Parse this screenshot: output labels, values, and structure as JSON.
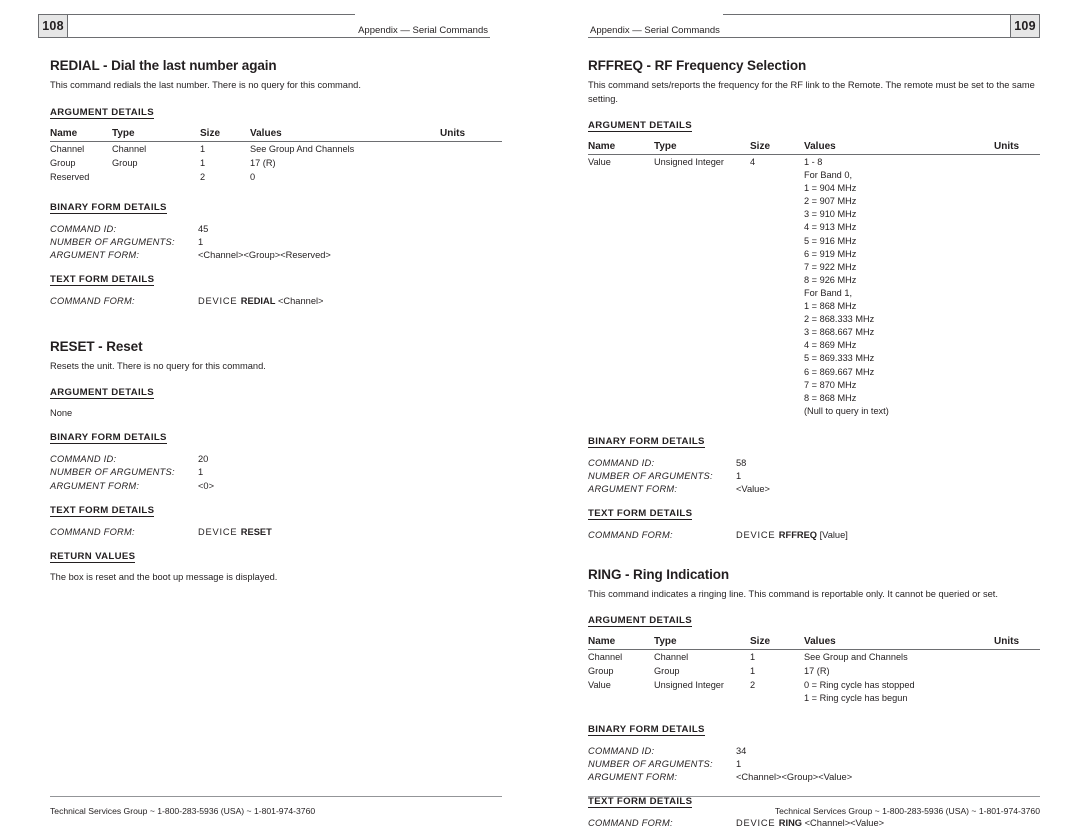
{
  "left_page": {
    "page_number": "108",
    "header_text": "Appendix — Serial Commands",
    "footer_text": "Technical Services Group ~ 1-800-283-5936 (USA) ~ 1-801-974-3760",
    "sections": [
      {
        "title": "REDIAL - Dial the last number again",
        "description": "This command redials the last number. There is no query for this command.",
        "argument_details_heading": "ARGUMENT DETAILS",
        "table": {
          "headers": [
            "Name",
            "Type",
            "Size",
            "Values",
            "Units"
          ],
          "rows": [
            {
              "name": "Channel",
              "type": "Channel",
              "size": "1",
              "values": [
                "See Group And Channels"
              ],
              "units": ""
            },
            {
              "name": "Group",
              "type": "Group",
              "size": "1",
              "values": [
                "17 (R)"
              ],
              "units": ""
            },
            {
              "name": "Reserved",
              "type": "",
              "size": "2",
              "values": [
                "0"
              ],
              "units": ""
            }
          ]
        },
        "binary_heading": "BINARY FORM DETAILS",
        "binary": {
          "command_id_label": "COMMAND ID:",
          "command_id": "45",
          "num_args_label": "NUMBER OF ARGUMENTS:",
          "num_args": "1",
          "arg_form_label": "ARGUMENT FORM:",
          "arg_form": "<Channel><Group><Reserved>"
        },
        "text_heading": "TEXT FORM DETAILS",
        "text_form": {
          "command_form_label": "COMMAND FORM:",
          "prefix": "DEVICE ",
          "command": "REDIAL",
          "suffix": " <Channel>"
        }
      },
      {
        "title": "RESET - Reset",
        "description": "Resets the unit. There is no query for this command.",
        "argument_details_heading": "ARGUMENT DETAILS",
        "arguments_none": "None",
        "binary_heading": "BINARY FORM DETAILS",
        "binary": {
          "command_id_label": "COMMAND ID:",
          "command_id": "20",
          "num_args_label": "NUMBER OF ARGUMENTS:",
          "num_args": "1",
          "arg_form_label": "ARGUMENT FORM:",
          "arg_form": "<0>"
        },
        "text_heading": "TEXT FORM DETAILS",
        "text_form": {
          "command_form_label": "COMMAND FORM:",
          "prefix": "DEVICE ",
          "command": "RESET",
          "suffix": ""
        },
        "return_heading": "RETURN VALUES",
        "return_text": "The box is reset and the boot up message is displayed."
      }
    ]
  },
  "right_page": {
    "page_number": "109",
    "header_text": "Appendix — Serial Commands",
    "footer_text": "Technical Services Group ~ 1-800-283-5936 (USA) ~ 1-801-974-3760",
    "sections": [
      {
        "title": "RFFREQ - RF Frequency Selection",
        "description": "This command sets/reports the frequency for the RF link to the Remote. The remote must be set to the same setting.",
        "argument_details_heading": "ARGUMENT DETAILS",
        "table": {
          "headers": [
            "Name",
            "Type",
            "Size",
            "Values",
            "Units"
          ],
          "rows": [
            {
              "name": "Value",
              "type": "Unsigned Integer",
              "size": "4",
              "values": [
                "1 - 8",
                "For Band 0,",
                "1 = 904 MHz",
                "2 = 907 MHz",
                "3 = 910 MHz",
                "4 = 913 MHz",
                "5 = 916 MHz",
                "6 = 919 MHz",
                "7 = 922 MHz",
                "8 = 926 MHz",
                "For Band 1,",
                "1 = 868 MHz",
                "2 = 868.333 MHz",
                "3 = 868.667 MHz",
                "4 = 869 MHz",
                "5 = 869.333 MHz",
                "6 = 869.667 MHz",
                "7 = 870 MHz",
                "8 = 868 MHz",
                "(Null to query in text)"
              ],
              "units": ""
            }
          ]
        },
        "binary_heading": "BINARY FORM DETAILS",
        "binary": {
          "command_id_label": "COMMAND ID:",
          "command_id": "58",
          "num_args_label": "NUMBER OF ARGUMENTS:",
          "num_args": "1",
          "arg_form_label": "ARGUMENT FORM:",
          "arg_form": "<Value>"
        },
        "text_heading": "TEXT FORM DETAILS",
        "text_form": {
          "command_form_label": "COMMAND FORM:",
          "prefix": "DEVICE ",
          "command": "RFFREQ",
          "suffix": " [Value]"
        }
      },
      {
        "title": "RING - Ring Indication",
        "description": "This command indicates a ringing line. This command is reportable only. It cannot be queried or set.",
        "argument_details_heading": "ARGUMENT DETAILS",
        "table": {
          "headers": [
            "Name",
            "Type",
            "Size",
            "Values",
            "Units"
          ],
          "rows": [
            {
              "name": "Channel",
              "type": "Channel",
              "size": "1",
              "values": [
                "See Group and Channels"
              ],
              "units": ""
            },
            {
              "name": "Group",
              "type": "Group",
              "size": "1",
              "values": [
                "17 (R)"
              ],
              "units": ""
            },
            {
              "name": "Value",
              "type": "Unsigned Integer",
              "size": "2",
              "values": [
                "0 = Ring cycle has stopped",
                "1 = Ring cycle has begun"
              ],
              "units": ""
            }
          ]
        },
        "binary_heading": "BINARY FORM DETAILS",
        "binary": {
          "command_id_label": "COMMAND ID:",
          "command_id": "34",
          "num_args_label": "NUMBER OF ARGUMENTS:",
          "num_args": "1",
          "arg_form_label": "ARGUMENT FORM:",
          "arg_form": "<Channel><Group><Value>"
        },
        "text_heading": "TEXT FORM DETAILS",
        "text_form": {
          "command_form_label": "COMMAND FORM:",
          "prefix": "DEVICE ",
          "command": "RING",
          "suffix": " <Channel><Value>"
        }
      }
    ]
  }
}
